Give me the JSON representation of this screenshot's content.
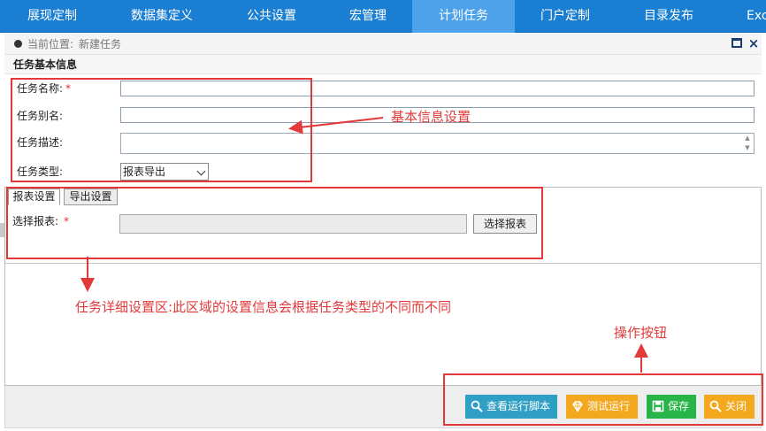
{
  "nav": {
    "items": [
      {
        "label": "展现定制"
      },
      {
        "label": "数据集定义"
      },
      {
        "label": "公共设置"
      },
      {
        "label": "宏管理"
      },
      {
        "label": "计划任务"
      },
      {
        "label": "门户定制"
      },
      {
        "label": "目录发布"
      },
      {
        "label": "Exc"
      }
    ],
    "active_index": 4,
    "bar_color": "#1a7fd2",
    "active_color": "#4ea2ea"
  },
  "breadcrumb": {
    "prefix": "当前位置:",
    "current": "新建任务"
  },
  "section": {
    "title": "任务基本信息"
  },
  "form": {
    "task_name_label": "任务名称:",
    "task_name_value": "",
    "task_alias_label": "任务别名:",
    "task_alias_value": "",
    "task_desc_label": "任务描述:",
    "task_desc_value": "",
    "task_type_label": "任务类型:",
    "task_type_value": "报表导出",
    "required_mark": "*"
  },
  "tabs": {
    "items": [
      {
        "label": "报表设置"
      },
      {
        "label": "导出设置"
      }
    ],
    "active_index": 0
  },
  "report": {
    "select_label": "选择报表:",
    "select_value": "",
    "choose_button": "选择报表"
  },
  "buttons": {
    "view_script": "查看运行脚本",
    "test_run": "测试运行",
    "save": "保存",
    "close": "关闭",
    "colors": {
      "view_script": "#2f9fc5",
      "test_run": "#f4a81e",
      "save": "#27b54a",
      "close": "#f4a81e"
    }
  },
  "annotations": {
    "basic_info": "基本信息设置",
    "detail_area": "任务详细设置区:此区域的设置信息会根据任务类型的不同而不同",
    "action_buttons": "操作按钮",
    "color": "#e23a3a"
  }
}
